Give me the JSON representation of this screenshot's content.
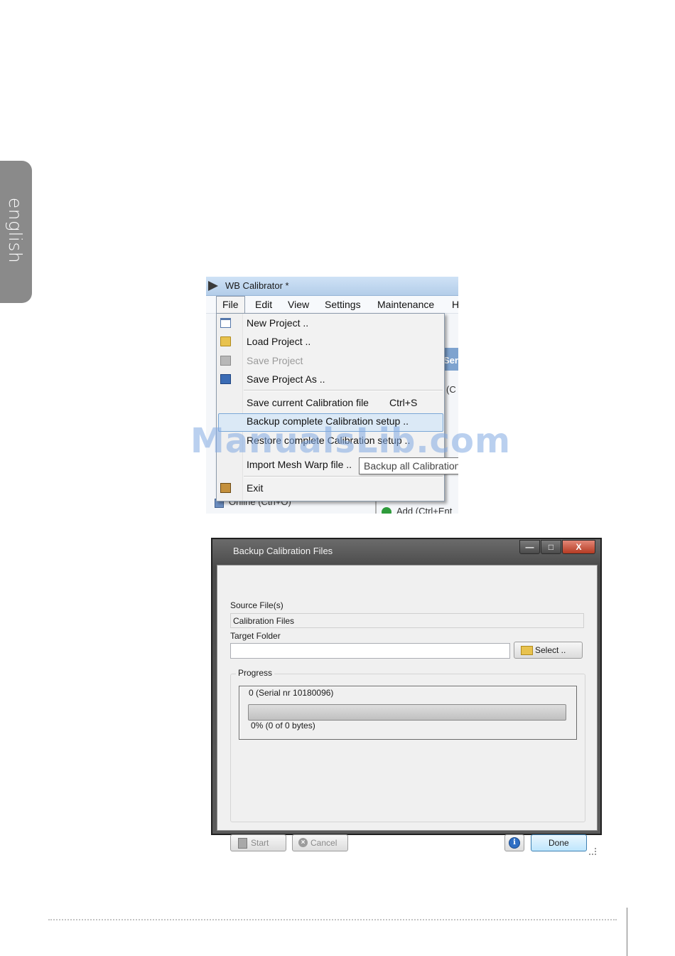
{
  "side_tab": {
    "label": "english"
  },
  "menu_screenshot": {
    "window_title": "WB Calibrator *",
    "menubar": [
      "File",
      "Edit",
      "View",
      "Settings",
      "Maintenance",
      "H"
    ],
    "background_texts": {
      "col_header": "Seri",
      "cell": "(C",
      "online": "Online (Ctrl+O)",
      "add": "Add (Ctrl+Ent"
    },
    "file_menu": [
      {
        "label": "New Project ..",
        "icon": "new-project-icon",
        "enabled": true
      },
      {
        "label": "Load Project ..",
        "icon": "folder-icon",
        "enabled": true
      },
      {
        "label": "Save Project",
        "icon": "save-icon",
        "enabled": false
      },
      {
        "label": "Save Project As ..",
        "icon": "save-as-icon",
        "enabled": true
      },
      {
        "label": "Save current Calibration file",
        "shortcut": "Ctrl+S",
        "enabled": true
      },
      {
        "label": "Backup complete Calibration setup ..",
        "enabled": true,
        "highlighted": true
      },
      {
        "label": "Restore complete Calibration setup ..",
        "enabled": true
      },
      {
        "label": "Import Mesh Warp file ..",
        "enabled": true
      },
      {
        "label": "Exit",
        "icon": "exit-icon",
        "enabled": true
      }
    ],
    "tooltip": "Backup all Calibration"
  },
  "watermark": "ManualsLib.com",
  "dialog": {
    "title": "Backup Calibration Files",
    "window_buttons": {
      "minimize": "—",
      "maximize": "□",
      "close": "X"
    },
    "source_label": "Source File(s)",
    "source_value": "Calibration Files",
    "target_label": "Target Folder",
    "target_value": "",
    "select_button": "Select ..",
    "progress_group": "Progress",
    "progress_item": "0 (Serial nr 10180096)",
    "progress_fraction": 0,
    "progress_text": "0% (0 of 0 bytes)",
    "start_button": "Start",
    "cancel_button": "Cancel",
    "info_button": "i",
    "done_button": "Done"
  }
}
